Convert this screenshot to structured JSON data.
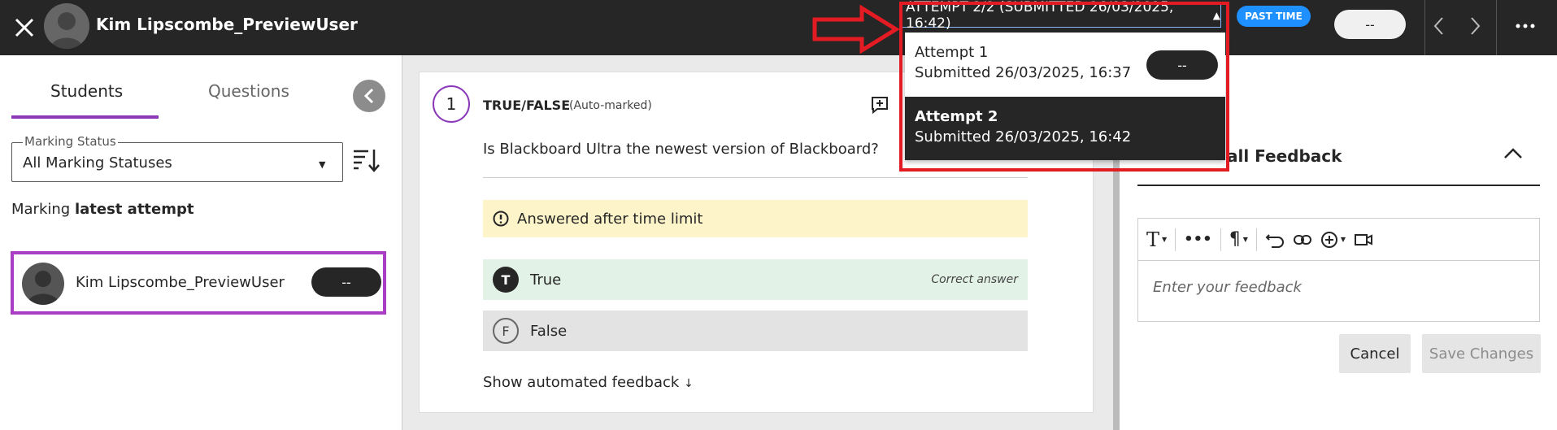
{
  "header": {
    "user_name": "Kim Lipscombe_PreviewUser",
    "attempt_selector": "ATTEMPT 2/2 (SUBMITTED 26/03/2025, 16:42)",
    "past_time_badge": "PAST TIME",
    "grade_value": "--"
  },
  "attempts": [
    {
      "label": "Attempt 1",
      "submitted": "Submitted 26/03/2025, 16:37",
      "grade": "--"
    },
    {
      "label": "Attempt 2",
      "submitted": "Submitted 26/03/2025, 16:42"
    }
  ],
  "left_panel": {
    "tabs": [
      "Students",
      "Questions"
    ],
    "marking_status_label": "Marking Status",
    "marking_status_value": "All Marking Statuses",
    "marking_prefix": "Marking",
    "marking_bold": "latest attempt",
    "student": {
      "name": "Kim Lipscombe_PreviewUser",
      "grade": "--"
    }
  },
  "question": {
    "number": "1",
    "type": "TRUE/FALSE",
    "auto": "(Auto-marked)",
    "text": "Is Blackboard Ultra the newest version of Blackboard?",
    "warning": "Answered after time limit",
    "answers": [
      {
        "letter": "T",
        "label": "True",
        "note": "Correct answer"
      },
      {
        "letter": "F",
        "label": "False"
      }
    ],
    "show_feedback": "Show automated feedback"
  },
  "right_panel": {
    "overall_feedback_title": "all Feedback",
    "placeholder": "Enter your feedback",
    "cancel": "Cancel",
    "save": "Save Changes"
  },
  "colors": {
    "topbar": "#262626",
    "accent_purple": "#8a3ab9",
    "callout_red": "#e31b23",
    "badge_blue": "#1e90ff"
  }
}
